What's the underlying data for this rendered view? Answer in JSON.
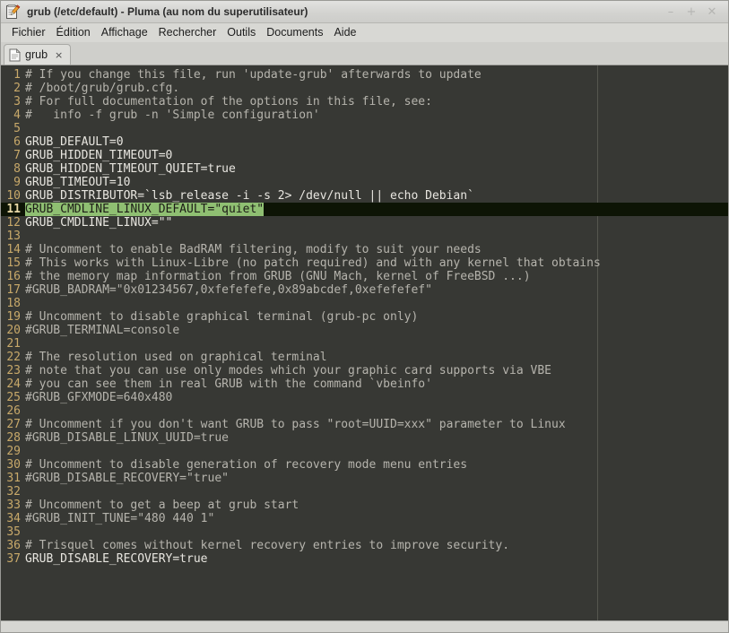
{
  "window": {
    "title": "grub (/etc/default) - Pluma (au nom du superutilisateur)",
    "icon": "pluma-notepad-pencil-icon",
    "controls": {
      "minimize": "–",
      "maximize": "+",
      "close": "✕"
    }
  },
  "menubar": {
    "items": [
      {
        "label": "Fichier"
      },
      {
        "label": "Édition"
      },
      {
        "label": "Affichage"
      },
      {
        "label": "Rechercher"
      },
      {
        "label": "Outils"
      },
      {
        "label": "Documents"
      },
      {
        "label": "Aide"
      }
    ]
  },
  "tabbar": {
    "tabs": [
      {
        "label": "grub",
        "icon": "document-icon",
        "close_label": "×",
        "active": true
      }
    ]
  },
  "editor": {
    "colors": {
      "background": "#373834",
      "text": "#e8e6e0",
      "comment": "#b6b4ad",
      "line_number": "#c8a96a",
      "selection": "#8fbf72",
      "current_line": "#0d1405",
      "margin_guide": "#55564f"
    },
    "margin_guide_column": 80,
    "lines": [
      {
        "n": 1,
        "text": "# If you change this file, run 'update-grub' afterwards to update",
        "comment": true
      },
      {
        "n": 2,
        "text": "# /boot/grub/grub.cfg.",
        "comment": true
      },
      {
        "n": 3,
        "text": "# For full documentation of the options in this file, see:",
        "comment": true
      },
      {
        "n": 4,
        "text": "#   info -f grub -n 'Simple configuration'",
        "comment": true
      },
      {
        "n": 5,
        "text": "",
        "comment": false
      },
      {
        "n": 6,
        "text": "GRUB_DEFAULT=0",
        "comment": false
      },
      {
        "n": 7,
        "text": "GRUB_HIDDEN_TIMEOUT=0",
        "comment": false
      },
      {
        "n": 8,
        "text": "GRUB_HIDDEN_TIMEOUT_QUIET=true",
        "comment": false
      },
      {
        "n": 9,
        "text": "GRUB_TIMEOUT=10",
        "comment": false
      },
      {
        "n": 10,
        "text": "GRUB_DISTRIBUTOR=`lsb_release -i -s 2> /dev/null || echo Debian`",
        "comment": false
      },
      {
        "n": 11,
        "text": "GRUB_CMDLINE_LINUX_DEFAULT=\"quiet\"",
        "comment": false,
        "selected": true,
        "current": true
      },
      {
        "n": 12,
        "text": "GRUB_CMDLINE_LINUX=\"\"",
        "comment": false
      },
      {
        "n": 13,
        "text": "",
        "comment": false
      },
      {
        "n": 14,
        "text": "# Uncomment to enable BadRAM filtering, modify to suit your needs",
        "comment": true
      },
      {
        "n": 15,
        "text": "# This works with Linux-Libre (no patch required) and with any kernel that obtains",
        "comment": true
      },
      {
        "n": 16,
        "text": "# the memory map information from GRUB (GNU Mach, kernel of FreeBSD ...)",
        "comment": true
      },
      {
        "n": 17,
        "text": "#GRUB_BADRAM=\"0x01234567,0xfefefefe,0x89abcdef,0xefefefef\"",
        "comment": true
      },
      {
        "n": 18,
        "text": "",
        "comment": false
      },
      {
        "n": 19,
        "text": "# Uncomment to disable graphical terminal (grub-pc only)",
        "comment": true
      },
      {
        "n": 20,
        "text": "#GRUB_TERMINAL=console",
        "comment": true
      },
      {
        "n": 21,
        "text": "",
        "comment": false
      },
      {
        "n": 22,
        "text": "# The resolution used on graphical terminal",
        "comment": true
      },
      {
        "n": 23,
        "text": "# note that you can use only modes which your graphic card supports via VBE",
        "comment": true
      },
      {
        "n": 24,
        "text": "# you can see them in real GRUB with the command `vbeinfo'",
        "comment": true
      },
      {
        "n": 25,
        "text": "#GRUB_GFXMODE=640x480",
        "comment": true
      },
      {
        "n": 26,
        "text": "",
        "comment": false
      },
      {
        "n": 27,
        "text": "# Uncomment if you don't want GRUB to pass \"root=UUID=xxx\" parameter to Linux",
        "comment": true
      },
      {
        "n": 28,
        "text": "#GRUB_DISABLE_LINUX_UUID=true",
        "comment": true
      },
      {
        "n": 29,
        "text": "",
        "comment": false
      },
      {
        "n": 30,
        "text": "# Uncomment to disable generation of recovery mode menu entries",
        "comment": true
      },
      {
        "n": 31,
        "text": "#GRUB_DISABLE_RECOVERY=\"true\"",
        "comment": true
      },
      {
        "n": 32,
        "text": "",
        "comment": false
      },
      {
        "n": 33,
        "text": "# Uncomment to get a beep at grub start",
        "comment": true
      },
      {
        "n": 34,
        "text": "#GRUB_INIT_TUNE=\"480 440 1\"",
        "comment": true
      },
      {
        "n": 35,
        "text": "",
        "comment": false
      },
      {
        "n": 36,
        "text": "# Trisquel comes without kernel recovery entries to improve security.",
        "comment": true
      },
      {
        "n": 37,
        "text": "GRUB_DISABLE_RECOVERY=true",
        "comment": false
      }
    ]
  },
  "statusbar": {
    "text": ""
  }
}
